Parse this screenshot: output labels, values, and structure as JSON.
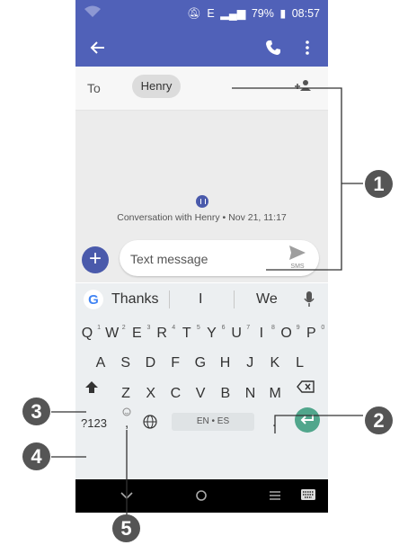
{
  "status_bar": {
    "signal": "E",
    "battery": "79%",
    "time": "08:57"
  },
  "app_bar": {
    "back_icon": "arrow-back-icon",
    "call_icon": "phone-icon",
    "more_icon": "more-vert-icon"
  },
  "recipient": {
    "to_label": "To",
    "chip_name": "Henry"
  },
  "conversation": {
    "info": "Conversation with Henry • Nov 21, 11:17"
  },
  "compose": {
    "placeholder": "Text message",
    "send_label": "SMS"
  },
  "keyboard": {
    "suggestions": [
      "Thanks",
      "I",
      "We"
    ],
    "row1": [
      {
        "key": "Q",
        "hint": "1"
      },
      {
        "key": "W",
        "hint": "2"
      },
      {
        "key": "E",
        "hint": "3"
      },
      {
        "key": "R",
        "hint": "4"
      },
      {
        "key": "T",
        "hint": "5"
      },
      {
        "key": "Y",
        "hint": "6"
      },
      {
        "key": "U",
        "hint": "7"
      },
      {
        "key": "I",
        "hint": "8"
      },
      {
        "key": "O",
        "hint": "9"
      },
      {
        "key": "P",
        "hint": "0"
      }
    ],
    "row2": [
      "A",
      "S",
      "D",
      "F",
      "G",
      "H",
      "J",
      "K",
      "L"
    ],
    "row3": [
      "Z",
      "X",
      "C",
      "V",
      "B",
      "N",
      "M"
    ],
    "symbols_key": "?123",
    "comma_key": ",",
    "space_label": "EN • ES",
    "period_key": "."
  },
  "callouts": [
    "1",
    "2",
    "3",
    "4",
    "5"
  ],
  "colors": {
    "primary": "#5061b8",
    "accent": "#4a5aab",
    "enter": "#51a68c",
    "callout": "#555555"
  }
}
